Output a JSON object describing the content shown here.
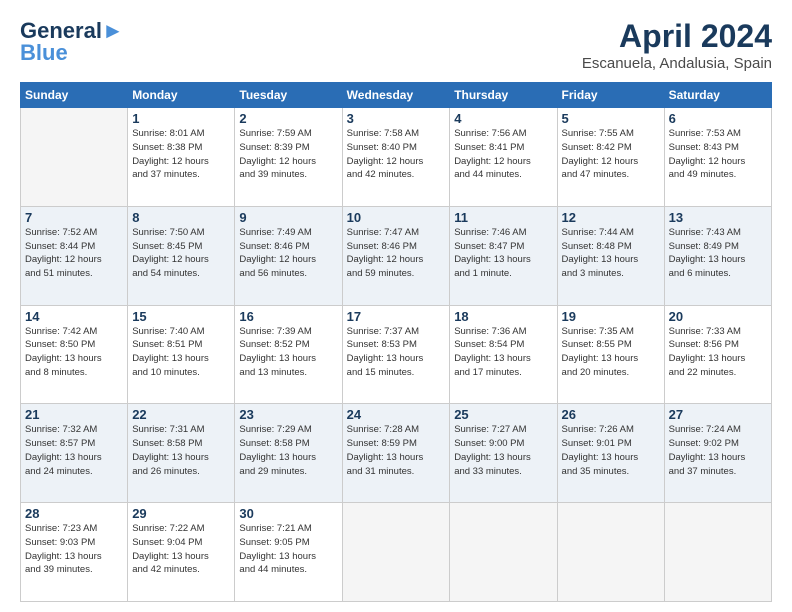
{
  "header": {
    "logo_line1": "General",
    "logo_line2": "Blue",
    "title": "April 2024",
    "subtitle": "Escanuela, Andalusia, Spain"
  },
  "weekdays": [
    "Sunday",
    "Monday",
    "Tuesday",
    "Wednesday",
    "Thursday",
    "Friday",
    "Saturday"
  ],
  "weeks": [
    [
      {
        "num": "",
        "info": ""
      },
      {
        "num": "1",
        "info": "Sunrise: 8:01 AM\nSunset: 8:38 PM\nDaylight: 12 hours\nand 37 minutes."
      },
      {
        "num": "2",
        "info": "Sunrise: 7:59 AM\nSunset: 8:39 PM\nDaylight: 12 hours\nand 39 minutes."
      },
      {
        "num": "3",
        "info": "Sunrise: 7:58 AM\nSunset: 8:40 PM\nDaylight: 12 hours\nand 42 minutes."
      },
      {
        "num": "4",
        "info": "Sunrise: 7:56 AM\nSunset: 8:41 PM\nDaylight: 12 hours\nand 44 minutes."
      },
      {
        "num": "5",
        "info": "Sunrise: 7:55 AM\nSunset: 8:42 PM\nDaylight: 12 hours\nand 47 minutes."
      },
      {
        "num": "6",
        "info": "Sunrise: 7:53 AM\nSunset: 8:43 PM\nDaylight: 12 hours\nand 49 minutes."
      }
    ],
    [
      {
        "num": "7",
        "info": "Sunrise: 7:52 AM\nSunset: 8:44 PM\nDaylight: 12 hours\nand 51 minutes."
      },
      {
        "num": "8",
        "info": "Sunrise: 7:50 AM\nSunset: 8:45 PM\nDaylight: 12 hours\nand 54 minutes."
      },
      {
        "num": "9",
        "info": "Sunrise: 7:49 AM\nSunset: 8:46 PM\nDaylight: 12 hours\nand 56 minutes."
      },
      {
        "num": "10",
        "info": "Sunrise: 7:47 AM\nSunset: 8:46 PM\nDaylight: 12 hours\nand 59 minutes."
      },
      {
        "num": "11",
        "info": "Sunrise: 7:46 AM\nSunset: 8:47 PM\nDaylight: 13 hours\nand 1 minute."
      },
      {
        "num": "12",
        "info": "Sunrise: 7:44 AM\nSunset: 8:48 PM\nDaylight: 13 hours\nand 3 minutes."
      },
      {
        "num": "13",
        "info": "Sunrise: 7:43 AM\nSunset: 8:49 PM\nDaylight: 13 hours\nand 6 minutes."
      }
    ],
    [
      {
        "num": "14",
        "info": "Sunrise: 7:42 AM\nSunset: 8:50 PM\nDaylight: 13 hours\nand 8 minutes."
      },
      {
        "num": "15",
        "info": "Sunrise: 7:40 AM\nSunset: 8:51 PM\nDaylight: 13 hours\nand 10 minutes."
      },
      {
        "num": "16",
        "info": "Sunrise: 7:39 AM\nSunset: 8:52 PM\nDaylight: 13 hours\nand 13 minutes."
      },
      {
        "num": "17",
        "info": "Sunrise: 7:37 AM\nSunset: 8:53 PM\nDaylight: 13 hours\nand 15 minutes."
      },
      {
        "num": "18",
        "info": "Sunrise: 7:36 AM\nSunset: 8:54 PM\nDaylight: 13 hours\nand 17 minutes."
      },
      {
        "num": "19",
        "info": "Sunrise: 7:35 AM\nSunset: 8:55 PM\nDaylight: 13 hours\nand 20 minutes."
      },
      {
        "num": "20",
        "info": "Sunrise: 7:33 AM\nSunset: 8:56 PM\nDaylight: 13 hours\nand 22 minutes."
      }
    ],
    [
      {
        "num": "21",
        "info": "Sunrise: 7:32 AM\nSunset: 8:57 PM\nDaylight: 13 hours\nand 24 minutes."
      },
      {
        "num": "22",
        "info": "Sunrise: 7:31 AM\nSunset: 8:58 PM\nDaylight: 13 hours\nand 26 minutes."
      },
      {
        "num": "23",
        "info": "Sunrise: 7:29 AM\nSunset: 8:58 PM\nDaylight: 13 hours\nand 29 minutes."
      },
      {
        "num": "24",
        "info": "Sunrise: 7:28 AM\nSunset: 8:59 PM\nDaylight: 13 hours\nand 31 minutes."
      },
      {
        "num": "25",
        "info": "Sunrise: 7:27 AM\nSunset: 9:00 PM\nDaylight: 13 hours\nand 33 minutes."
      },
      {
        "num": "26",
        "info": "Sunrise: 7:26 AM\nSunset: 9:01 PM\nDaylight: 13 hours\nand 35 minutes."
      },
      {
        "num": "27",
        "info": "Sunrise: 7:24 AM\nSunset: 9:02 PM\nDaylight: 13 hours\nand 37 minutes."
      }
    ],
    [
      {
        "num": "28",
        "info": "Sunrise: 7:23 AM\nSunset: 9:03 PM\nDaylight: 13 hours\nand 39 minutes."
      },
      {
        "num": "29",
        "info": "Sunrise: 7:22 AM\nSunset: 9:04 PM\nDaylight: 13 hours\nand 42 minutes."
      },
      {
        "num": "30",
        "info": "Sunrise: 7:21 AM\nSunset: 9:05 PM\nDaylight: 13 hours\nand 44 minutes."
      },
      {
        "num": "",
        "info": ""
      },
      {
        "num": "",
        "info": ""
      },
      {
        "num": "",
        "info": ""
      },
      {
        "num": "",
        "info": ""
      }
    ]
  ]
}
